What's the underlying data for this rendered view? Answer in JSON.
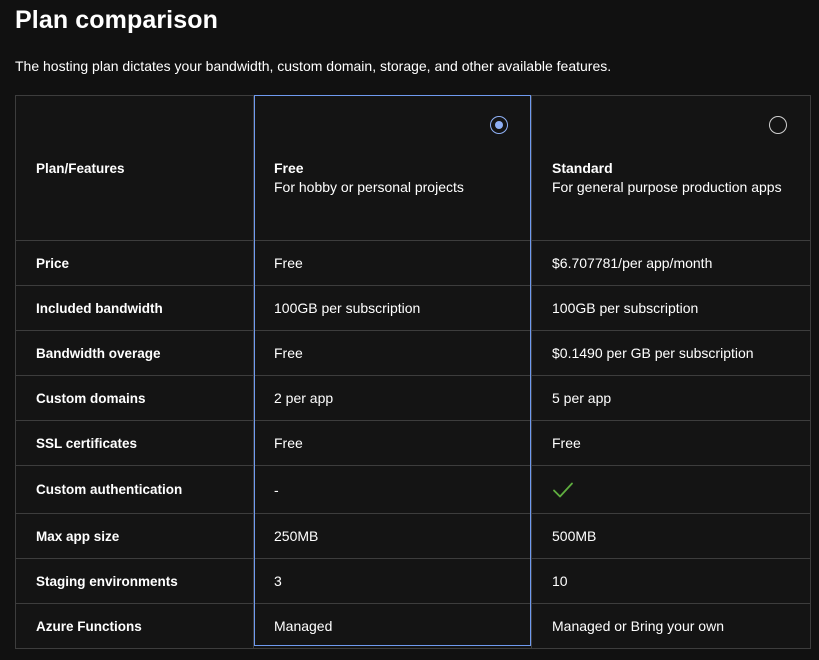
{
  "header": {
    "title": "Plan comparison",
    "description": "The hosting plan dictates your bandwidth, custom domain, storage, and other available features."
  },
  "table": {
    "corner_label": "Plan/Features",
    "plans": [
      {
        "name": "Free",
        "subtitle": "For hobby or personal projects",
        "selected": true
      },
      {
        "name": "Standard",
        "subtitle": "For general purpose production apps",
        "selected": false
      }
    ],
    "rows": [
      {
        "feature": "Price",
        "free": "Free",
        "standard": "$6.707781/per app/month"
      },
      {
        "feature": "Included bandwidth",
        "free": "100GB per subscription",
        "standard": "100GB per subscription"
      },
      {
        "feature": "Bandwidth overage",
        "free": "Free",
        "standard": "$0.1490 per GB per subscription"
      },
      {
        "feature": "Custom domains",
        "free": "2 per app",
        "standard": "5 per app"
      },
      {
        "feature": "SSL certificates",
        "free": "Free",
        "standard": "Free"
      },
      {
        "feature": "Custom authentication",
        "free": "-",
        "standard_icon": "checkmark-icon"
      },
      {
        "feature": "Max app size",
        "free": "250MB",
        "standard": "500MB"
      },
      {
        "feature": "Staging environments",
        "free": "3",
        "standard": "10"
      },
      {
        "feature": "Azure Functions",
        "free": "Managed",
        "standard": "Managed or Bring your own"
      }
    ]
  },
  "colors": {
    "background": "#111111",
    "selected_accent": "#8fb0f5",
    "check_green": "#5fae3f",
    "border": "#3d3d3d"
  }
}
